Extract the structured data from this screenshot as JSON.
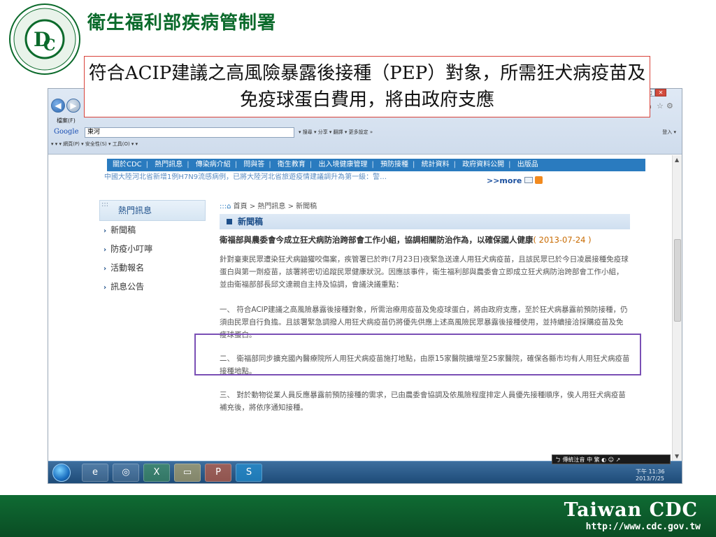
{
  "slide": {
    "org_title": "衛生福利部疾病管制署",
    "logo_text_cn": "衛生福利部疾病管制署",
    "logo_text_en": "Centers for Disease Control",
    "highlight_title": "符合ACIP建議之高風險暴露後接種（PEP）對象，所需狂犬病疫苗及免疫球蛋白費用，將由政府支應",
    "footer_brand": "Taiwan CDC",
    "footer_url": "http://www.cdc.gov.tw"
  },
  "browser": {
    "menu_file": "檔案(F)",
    "google_label": "Google",
    "google_query": "東河",
    "google_tools": "▾ 搜尋 ▾  分享 ▾  翻譯 ▾ 更多設定 »",
    "google_login": "登入 ▾",
    "command_bar": "▾ ▾ ▾ 網頁(P) ▾ 安全性(S) ▾ 工具(O) ▾ ▾"
  },
  "site": {
    "menu": [
      "關於CDC",
      "熱門訊息",
      "傳染病介紹",
      "問與答",
      "衛生教育",
      "出入境健康管理",
      "預防接種",
      "統計資料",
      "政府資料公開",
      "出版品"
    ],
    "marquee": "中國大陸河北省新增1例H7N9流感病例，已將大陸河北省旅遊疫情建議調升為第一級：警…",
    "more": ">>more",
    "sidebar_title": "熱門訊息",
    "sidebar_items": [
      "新聞稿",
      "防疫小叮嚀",
      "活動報名",
      "訊息公告"
    ],
    "breadcrumb": "首頁 > 熱門訊息 > 新聞稿",
    "section_title": "新聞稿",
    "headline": "衛福部與農委會今成立狂犬病防治跨部會工作小組，協調相關防治作為，以確保國人健康",
    "headline_date": "( 2013-07-24 )",
    "para1": "針對臺東民眾遭染狂犬病鼬獾咬傷案，疾管署已於昨(7月23日)夜緊急送達人用狂犬病疫苗，且該民眾已於今日凌晨接種免疫球蛋白與第一劑疫苗，該署將密切追蹤民眾健康狀況。因應該事件，衛生福利部與農委會立即成立狂犬病防治跨部會工作小組，並由衛福部部長邱文達親自主持及協調，會議決議重點：",
    "para2": "一、 符合ACIP建議之高風險暴露後接種對象，所需治療用疫苗及免疫球蛋白，將由政府支應，至於狂犬病暴露前預防接種，仍須由民眾自行負擔。且該署緊急調撥人用狂犬病疫苗仍將優先供應上述高風險民眾暴露後接種使用，並持續接洽採購疫苗及免疫球蛋白。",
    "para3": "二、 衛福部同步擴充國內醫療院所人用狂犬病疫苗施打地點，由原15家醫院擴增至25家醫院，確保各縣市均有人用狂犬病疫苗接種地點。",
    "para4": "三、 對於動物從業人員反應暴露前預防接種的需求，已由農委會協調及依風險程度排定人員優先接種順序，俟人用狂犬病疫苗補充後，將依序通知接種。"
  },
  "taskbar": {
    "ime": "ㄅ 傳統注音  中 繁 ◐ ☺ ↗",
    "time": "下午 11:36",
    "date": "2013/7/25"
  },
  "colors": {
    "brand_green": "#0b6a2b",
    "menu_blue": "#2a7bbf",
    "highlight_red": "#d9423a",
    "highlight_purple": "#7a4fb5"
  }
}
